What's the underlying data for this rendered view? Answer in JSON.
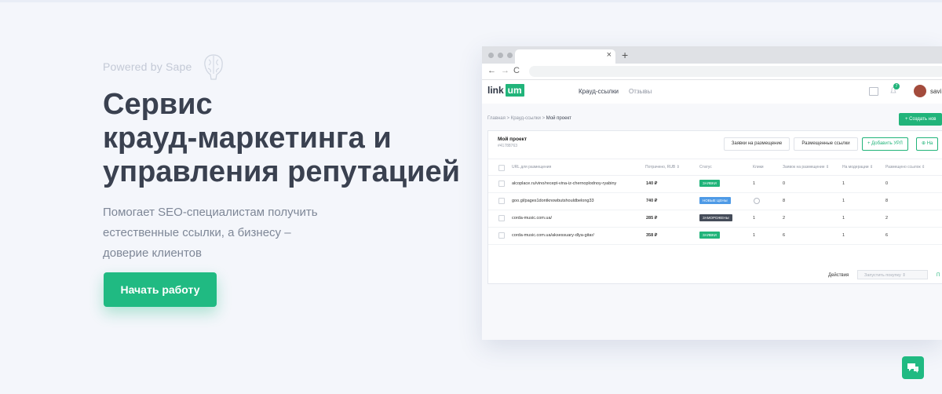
{
  "hero": {
    "powered": "Powered by Sape",
    "title_lines": [
      "Сервис",
      "крауд-маркетинга и",
      "управления репутацией"
    ],
    "subtitle_lines": [
      "Помогает SEO-специалистам получить",
      "естественные ссылки, а бизнесу –",
      "доверие клиентов"
    ],
    "cta": "Начать работу"
  },
  "browser": {
    "close": "×",
    "new_tab": "+",
    "back": "←",
    "forward": "→",
    "reload": "C"
  },
  "app": {
    "logo_a": "link",
    "logo_b": "um",
    "nav": [
      "Крауд-ссылки",
      "Отзывы"
    ],
    "badge": "7",
    "user": "savi",
    "breadcrumbs": [
      "Главная",
      "Крауд-ссылки",
      "Мой проект"
    ],
    "crumb_sep": ">",
    "create_btn": "Создать нов",
    "project": {
      "name": "Мой проект",
      "id": "#41788763"
    },
    "buttons": {
      "requests": "Заявки на размещение",
      "placed": "Размещенные ссылки",
      "add_url": "Добавить УРЛ",
      "settings": "На"
    },
    "columns": [
      "URL для размещения",
      "Потрачено, RUB ⇕",
      "Статус",
      "Клики",
      "Заявок на размещение ⇕",
      "На модерации ⇕",
      "Размещено ссылок ⇕"
    ],
    "rows": [
      {
        "url": "alcoplace.ru/vino/recept-vina-iz-chernoplodnoy-ryabiny",
        "spent": "140 ₽",
        "status": "ЗАЯВКИ",
        "status_color": "green",
        "clicks": "1",
        "requests": "0",
        "moderation": "1",
        "placed": "0"
      },
      {
        "url": "goo.gl/pages1dontknowbutshouldbelong33",
        "spent": "740 ₽",
        "status": "НОВЫЕ ЦЕНЫ",
        "status_color": "blue",
        "clicks": "",
        "requests": "8",
        "moderation": "1",
        "placed": "8"
      },
      {
        "url": "corda-music.com.ua/",
        "spent": "285 ₽",
        "status": "ЗАМОРОЖЕНЫ",
        "status_color": "dark",
        "clicks": "1",
        "requests": "2",
        "moderation": "1",
        "placed": "2"
      },
      {
        "url": "corda-music.com.ua/aksessuary-dlya-gitar/",
        "spent": "358 ₽",
        "status": "ЗАЯВКИ",
        "status_color": "green",
        "clicks": "1",
        "requests": "6",
        "moderation": "1",
        "placed": "6"
      }
    ],
    "footer": {
      "actions": "Действия",
      "select": "Запустить покупку ⇕",
      "next": "П"
    }
  }
}
